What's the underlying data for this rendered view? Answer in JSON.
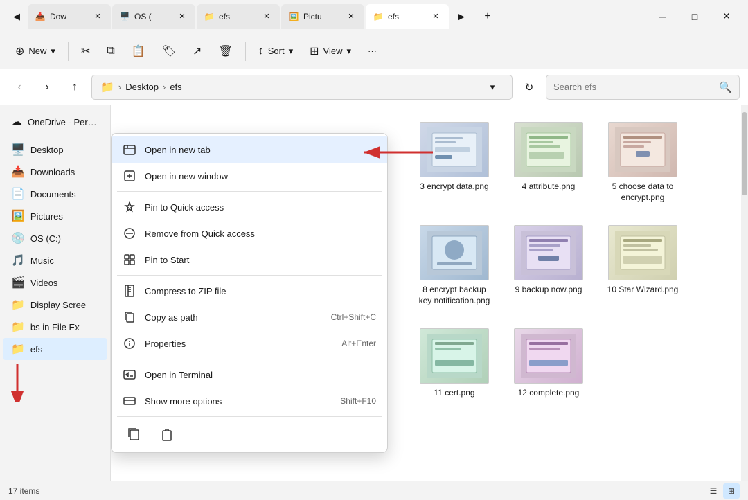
{
  "tabs": [
    {
      "id": "tab1",
      "label": "Dow",
      "icon": "📥",
      "active": false
    },
    {
      "id": "tab2",
      "label": "OS (",
      "icon": "🖥️",
      "active": false
    },
    {
      "id": "tab3",
      "label": "efs",
      "icon": "📁",
      "active": false
    },
    {
      "id": "tab4",
      "label": "Pictu",
      "icon": "🖼️",
      "active": false
    },
    {
      "id": "tab5",
      "label": "efs",
      "icon": "📁",
      "active": true
    }
  ],
  "toolbar": {
    "new_label": "New",
    "sort_label": "Sort",
    "view_label": "View",
    "more_label": "···"
  },
  "address": {
    "path_desktop": "Desktop",
    "path_efs": "efs",
    "search_placeholder": "Search efs"
  },
  "sidebar": {
    "onedrive_label": "OneDrive - Personal",
    "items": [
      {
        "id": "desktop",
        "label": "Desktop",
        "icon": "🖥️",
        "active": false
      },
      {
        "id": "downloads",
        "label": "Downloads",
        "icon": "📥",
        "active": false
      },
      {
        "id": "documents",
        "label": "Documents",
        "icon": "🗋",
        "active": false
      },
      {
        "id": "pictures",
        "label": "Pictures",
        "icon": "🖼️",
        "active": false
      },
      {
        "id": "os-c",
        "label": "OS (C:)",
        "icon": "💿",
        "active": false
      },
      {
        "id": "music",
        "label": "Music",
        "icon": "🎵",
        "active": false
      },
      {
        "id": "videos",
        "label": "Videos",
        "icon": "🎬",
        "active": false
      },
      {
        "id": "display",
        "label": "Display Scree",
        "icon": "📁",
        "active": false
      },
      {
        "id": "bsfe",
        "label": "bs in File Ex",
        "icon": "📁",
        "active": false
      },
      {
        "id": "efs",
        "label": "efs",
        "icon": "📁",
        "active": true
      }
    ]
  },
  "context_menu": {
    "items": [
      {
        "id": "open-new-tab",
        "label": "Open in new tab",
        "icon": "tab",
        "shortcut": "",
        "highlighted": true
      },
      {
        "id": "open-new-window",
        "label": "Open in new window",
        "icon": "window",
        "shortcut": ""
      },
      {
        "id": "pin-quick",
        "label": "Pin to Quick access",
        "icon": "pin",
        "shortcut": ""
      },
      {
        "id": "remove-quick",
        "label": "Remove from Quick access",
        "icon": "remove",
        "shortcut": ""
      },
      {
        "id": "pin-start",
        "label": "Pin to Start",
        "icon": "start",
        "shortcut": ""
      },
      {
        "id": "compress-zip",
        "label": "Compress to ZIP file",
        "icon": "zip",
        "shortcut": ""
      },
      {
        "id": "copy-path",
        "label": "Copy as path",
        "icon": "copy-path",
        "shortcut": "Ctrl+Shift+C"
      },
      {
        "id": "properties",
        "label": "Properties",
        "icon": "properties",
        "shortcut": "Alt+Enter"
      },
      {
        "id": "open-terminal",
        "label": "Open in Terminal",
        "icon": "terminal",
        "shortcut": ""
      },
      {
        "id": "show-more",
        "label": "Show more options",
        "icon": "more",
        "shortcut": "Shift+F10"
      }
    ]
  },
  "files": [
    {
      "id": "f3",
      "name": "3 encrypt data.png",
      "thumb": "3"
    },
    {
      "id": "f4",
      "name": "4 attribute.png",
      "thumb": "4"
    },
    {
      "id": "f5",
      "name": "5 choose data to encrypt.png",
      "thumb": "5"
    },
    {
      "id": "f8",
      "name": "8 encrypt backup key notification.png",
      "thumb": "8"
    },
    {
      "id": "f9",
      "name": "9 backup now.png",
      "thumb": "9"
    },
    {
      "id": "f10",
      "name": "10 Star Wizard.png",
      "thumb": "10"
    },
    {
      "id": "f11",
      "name": "11 cert.png",
      "thumb": "11"
    },
    {
      "id": "f12",
      "name": "12 complete.png",
      "thumb": "12"
    }
  ],
  "status": {
    "count": "17 items"
  }
}
